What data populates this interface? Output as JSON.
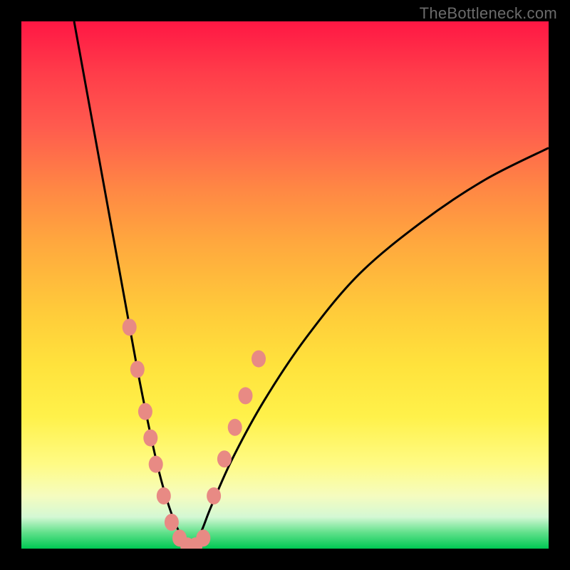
{
  "watermark": "TheBottleneck.com",
  "chart_data": {
    "type": "line",
    "title": "",
    "xlabel": "",
    "ylabel": "",
    "xlim": [
      0,
      100
    ],
    "ylim": [
      0,
      100
    ],
    "grid": false,
    "legend": false,
    "series": [
      {
        "name": "left-curve",
        "x": [
          10,
          14,
          18,
          20,
          22,
          24,
          26,
          28,
          30,
          32
        ],
        "y": [
          100,
          78,
          56,
          45,
          34,
          24,
          15,
          8,
          3,
          0
        ]
      },
      {
        "name": "right-curve",
        "x": [
          32,
          34,
          36,
          40,
          46,
          54,
          64,
          76,
          88,
          100
        ],
        "y": [
          0,
          3,
          8,
          17,
          28,
          40,
          52,
          62,
          70,
          76
        ]
      }
    ],
    "scatter": {
      "name": "markers",
      "color": "#e88a84",
      "points": [
        {
          "x": 20.5,
          "y": 42
        },
        {
          "x": 22.0,
          "y": 34
        },
        {
          "x": 23.5,
          "y": 26
        },
        {
          "x": 24.5,
          "y": 21
        },
        {
          "x": 25.5,
          "y": 16
        },
        {
          "x": 27.0,
          "y": 10
        },
        {
          "x": 28.5,
          "y": 5
        },
        {
          "x": 30.0,
          "y": 2
        },
        {
          "x": 31.5,
          "y": 0.5
        },
        {
          "x": 33.0,
          "y": 0.5
        },
        {
          "x": 34.5,
          "y": 2
        },
        {
          "x": 36.5,
          "y": 10
        },
        {
          "x": 38.5,
          "y": 17
        },
        {
          "x": 40.5,
          "y": 23
        },
        {
          "x": 42.5,
          "y": 29
        },
        {
          "x": 45.0,
          "y": 36
        }
      ]
    },
    "gradient_stops": [
      {
        "pos": 0,
        "color": "#ff1744"
      },
      {
        "pos": 50,
        "color": "#ffcb3a"
      },
      {
        "pos": 80,
        "color": "#fffb85"
      },
      {
        "pos": 100,
        "color": "#00c853"
      }
    ]
  }
}
